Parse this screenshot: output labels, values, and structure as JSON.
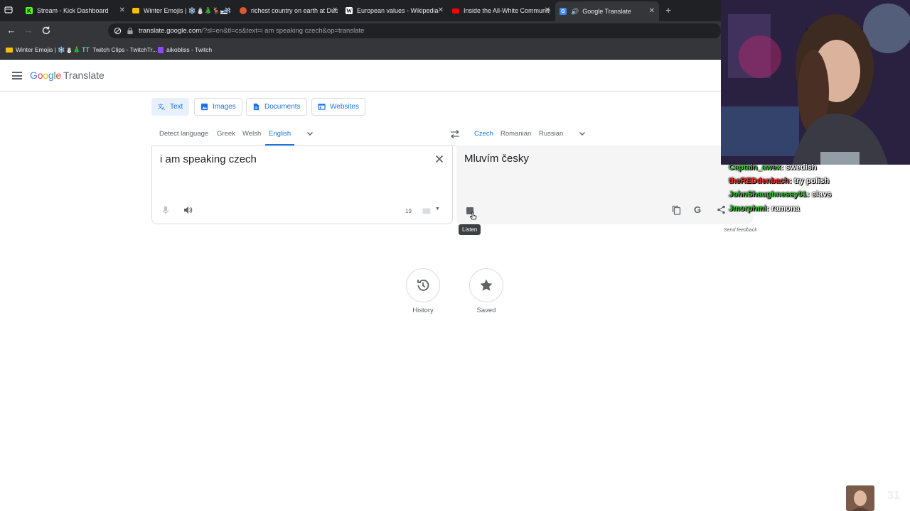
{
  "browser": {
    "tabs": [
      {
        "label": "Stream - Kick Dashboard",
        "icon": "kick-icon",
        "color": "#53fc18"
      },
      {
        "label": "Winter Emojis | ❄️⛄🎄🦌🎿❄️",
        "icon": "folder-icon",
        "color": "#fbbc04"
      },
      {
        "label": "richest country on earth at Duck",
        "icon": "duckduckgo-icon",
        "color": "#de5833"
      },
      {
        "label": "European values - Wikipedia",
        "icon": "wikipedia-icon",
        "color": "#ffffff"
      },
      {
        "label": "Inside the All-White Community",
        "icon": "youtube-icon",
        "color": "#ff0000"
      },
      {
        "label": "Google Translate",
        "icon": "google-translate-icon",
        "color": "#4285f4",
        "active": true
      }
    ],
    "address": {
      "domain": "translate.google.com",
      "path": "/?sl=en&tl=cs&text=i am speaking czech&op=translate"
    },
    "bookmarks": [
      {
        "label": "Winter Emojis | ❄️⛄🎄",
        "icon": "folder-icon"
      },
      {
        "label": "Twitch Clips - TwitchTr...",
        "icon": "twitchtracker-icon"
      },
      {
        "label": "aikobliss - Twitch",
        "icon": "twitch-icon"
      }
    ]
  },
  "translate": {
    "logo_word": "Google",
    "logo_product": "Translate",
    "modes": [
      {
        "label": "Text",
        "icon": "translate-icon",
        "active": true
      },
      {
        "label": "Images",
        "icon": "image-icon"
      },
      {
        "label": "Documents",
        "icon": "document-icon"
      },
      {
        "label": "Websites",
        "icon": "website-icon"
      }
    ],
    "source_languages": [
      "Detect language",
      "Greek",
      "Welsh",
      "English"
    ],
    "source_selected": "English",
    "target_languages": [
      "Czech",
      "Romanian",
      "Russian"
    ],
    "target_selected": "Czech",
    "source_text": "i am speaking czech",
    "char_count": "19",
    "target_text": "Mluvím česky",
    "tooltip": "Listen",
    "send_feedback": "Send feedback",
    "history_label": "History",
    "saved_label": "Saved"
  },
  "stream": {
    "chat": [
      {
        "user": "Captain_awex",
        "message": "swedish",
        "color": "#3cbf3c"
      },
      {
        "user": "theREDdenbach",
        "message": "try polish",
        "color": "#ff2a2a"
      },
      {
        "user": "JohnShaughnessy01",
        "message": "slavs",
        "color": "#3cbf3c"
      },
      {
        "user": "Jmorphmi",
        "message": "ramona",
        "color": "#2fd12f"
      }
    ],
    "viewer_count": "31"
  }
}
